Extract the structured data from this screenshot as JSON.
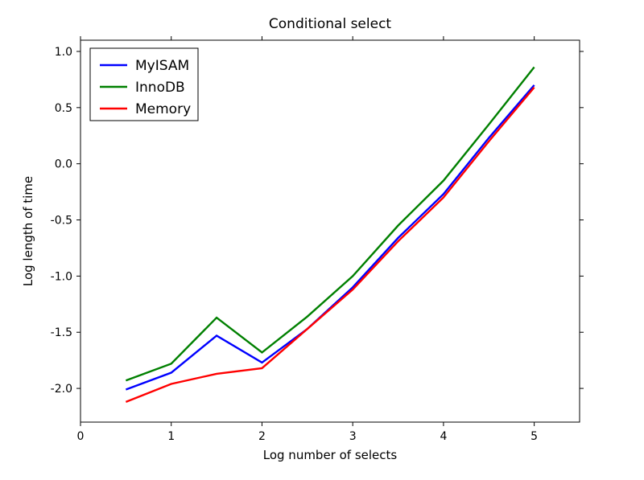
{
  "chart_data": {
    "type": "line",
    "title": "Conditional select",
    "xlabel": "Log number of selects",
    "ylabel": "Log length of time",
    "xlim": [
      0,
      5.5
    ],
    "ylim": [
      -2.3,
      1.1
    ],
    "xticks": [
      0,
      1,
      2,
      3,
      4,
      5
    ],
    "yticks": [
      -2.0,
      -1.5,
      -1.0,
      -0.5,
      0.0,
      0.5,
      1.0
    ],
    "xtick_labels": [
      "0",
      "1",
      "2",
      "3",
      "4",
      "5"
    ],
    "ytick_labels": [
      "-2.0",
      "-1.5",
      "-1.0",
      "-0.5",
      "0.0",
      "0.5",
      "1.0"
    ],
    "x": [
      0.5,
      1.0,
      1.5,
      2.0,
      2.5,
      3.0,
      3.5,
      4.0,
      4.5,
      5.0
    ],
    "series": [
      {
        "name": "MyISAM",
        "color": "#0000ff",
        "values": [
          -2.01,
          -1.86,
          -1.53,
          -1.77,
          -1.47,
          -1.1,
          -0.66,
          -0.27,
          0.23,
          0.7
        ]
      },
      {
        "name": "InnoDB",
        "color": "#008000",
        "values": [
          -1.93,
          -1.78,
          -1.37,
          -1.68,
          -1.36,
          -1.0,
          -0.55,
          -0.15,
          0.35,
          0.86
        ]
      },
      {
        "name": "Memory",
        "color": "#ff0000",
        "values": [
          -2.12,
          -1.96,
          -1.87,
          -1.82,
          -1.47,
          -1.12,
          -0.69,
          -0.3,
          0.2,
          0.68
        ]
      }
    ],
    "legend_position": "upper-left"
  }
}
